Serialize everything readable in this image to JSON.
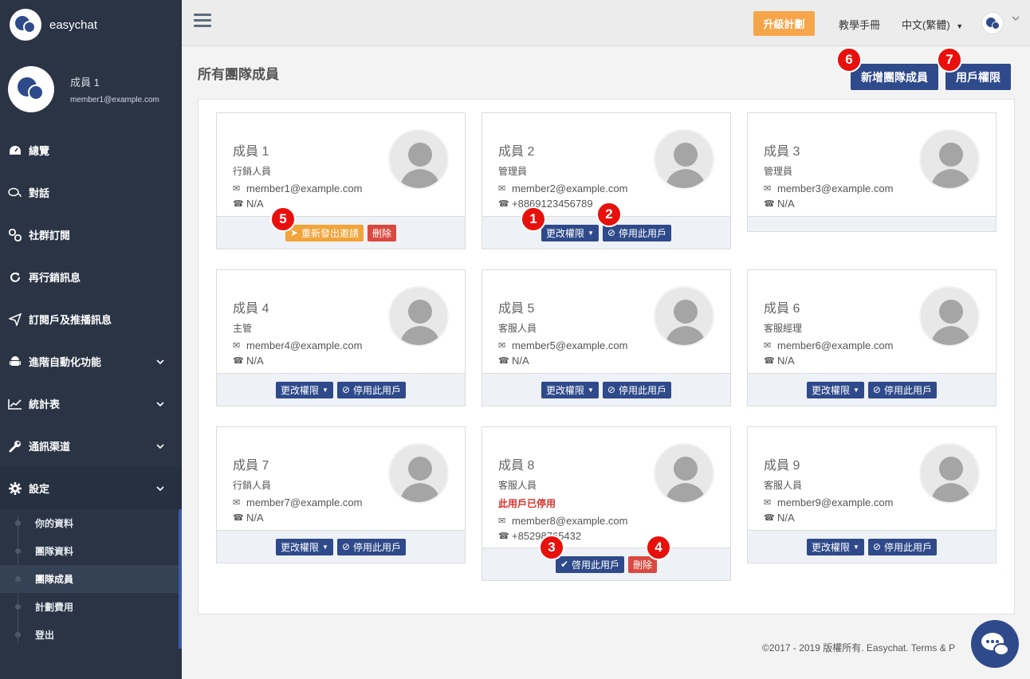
{
  "app": {
    "name": "easychat"
  },
  "profile": {
    "name": "成員 1",
    "email": "member1@example.com"
  },
  "nav": [
    {
      "label": "總覽",
      "icon": "dashboard-icon"
    },
    {
      "label": "對話",
      "icon": "chat-icon"
    },
    {
      "label": "社群訂閱",
      "icon": "link-icon"
    },
    {
      "label": "再行銷訊息",
      "icon": "refresh-icon"
    },
    {
      "label": "訂閱戶及推播訊息",
      "icon": "send-icon"
    },
    {
      "label": "進階自動化功能",
      "icon": "android-icon"
    },
    {
      "label": "統計表",
      "icon": "chart-icon"
    },
    {
      "label": "通訊渠道",
      "icon": "wrench-icon"
    },
    {
      "label": "設定",
      "icon": "gear-icon"
    }
  ],
  "subnav": [
    "你的資料",
    "團隊資料",
    "團隊成員",
    "計劃費用",
    "登出"
  ],
  "topbar": {
    "upgrade": "升級計劃",
    "manual": "教學手冊",
    "language": "中文(繁體)"
  },
  "page": {
    "title": "所有團隊成員",
    "add_member": "新增團隊成員",
    "permissions": "用戶權限"
  },
  "buttons": {
    "change_role": "更改權限",
    "disable": "停用此用戶",
    "enable": "啓用此用戶",
    "delete": "刪除",
    "resend": "重新發出邀請"
  },
  "members": [
    {
      "name": "成員 1",
      "role": "行銷人員",
      "email": "member1@example.com",
      "phone": "N/A"
    },
    {
      "name": "成員 2",
      "role": "管理員",
      "email": "member2@example.com",
      "phone": "+8869123456789"
    },
    {
      "name": "成員 3",
      "role": "管理員",
      "email": "member3@example.com",
      "phone": "N/A"
    },
    {
      "name": "成員 4",
      "role": "主管",
      "email": "member4@example.com",
      "phone": "N/A"
    },
    {
      "name": "成員 5",
      "role": "客服人員",
      "email": "member5@example.com",
      "phone": "N/A"
    },
    {
      "name": "成員 6",
      "role": "客服經理",
      "email": "member6@example.com",
      "phone": "N/A"
    },
    {
      "name": "成員 7",
      "role": "行銷人員",
      "email": "member7@example.com",
      "phone": "N/A"
    },
    {
      "name": "成員 8",
      "role": "客服人員",
      "status": "此用戶已停用",
      "email": "member8@example.com",
      "phone": "+85298765432"
    },
    {
      "name": "成員 9",
      "role": "客服人員",
      "email": "member9@example.com",
      "phone": "N/A"
    }
  ],
  "badges": [
    "1",
    "2",
    "3",
    "4",
    "5",
    "6",
    "7"
  ],
  "footer": {
    "copyright": "©2017 - 2019 版權所有. Easychat. Terms & P"
  },
  "colors": {
    "sidebar": "#2a3445",
    "primary": "#2f4a8a",
    "danger": "#d9493f",
    "warning": "#f0a43a",
    "badge": "#e8100c"
  }
}
